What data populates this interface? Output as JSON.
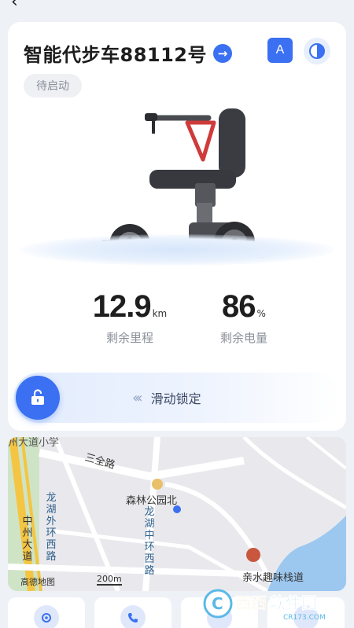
{
  "device": {
    "name": "智能代步车88112号",
    "status": "待启动",
    "mode_badge": "A"
  },
  "stats": {
    "range_value": "12.9",
    "range_unit": "km",
    "range_label": "剩余里程",
    "battery_value": "86",
    "battery_unit": "%",
    "battery_label": "剩余电量"
  },
  "slider": {
    "label": "滑动锁定"
  },
  "map": {
    "labels": {
      "sanquan_road": "三全路",
      "senlin_park_north": "森林公园北",
      "longhu_zhonghuan_west": "龙湖中环西路",
      "longhu_waihuan_west": "龙湖外环西路",
      "zhongzhou_avenue": "中州大道",
      "qinshui_trail": "亲水趣味栈道",
      "top_school": "州大道小学",
      "scale": "200m",
      "provider": "高德地图"
    }
  },
  "watermark": {
    "brand": "西西软件园",
    "domain": "CR173.COM"
  },
  "colors": {
    "accent": "#3a70f1",
    "background": "#eef1f6",
    "water": "#9cc8f0"
  }
}
